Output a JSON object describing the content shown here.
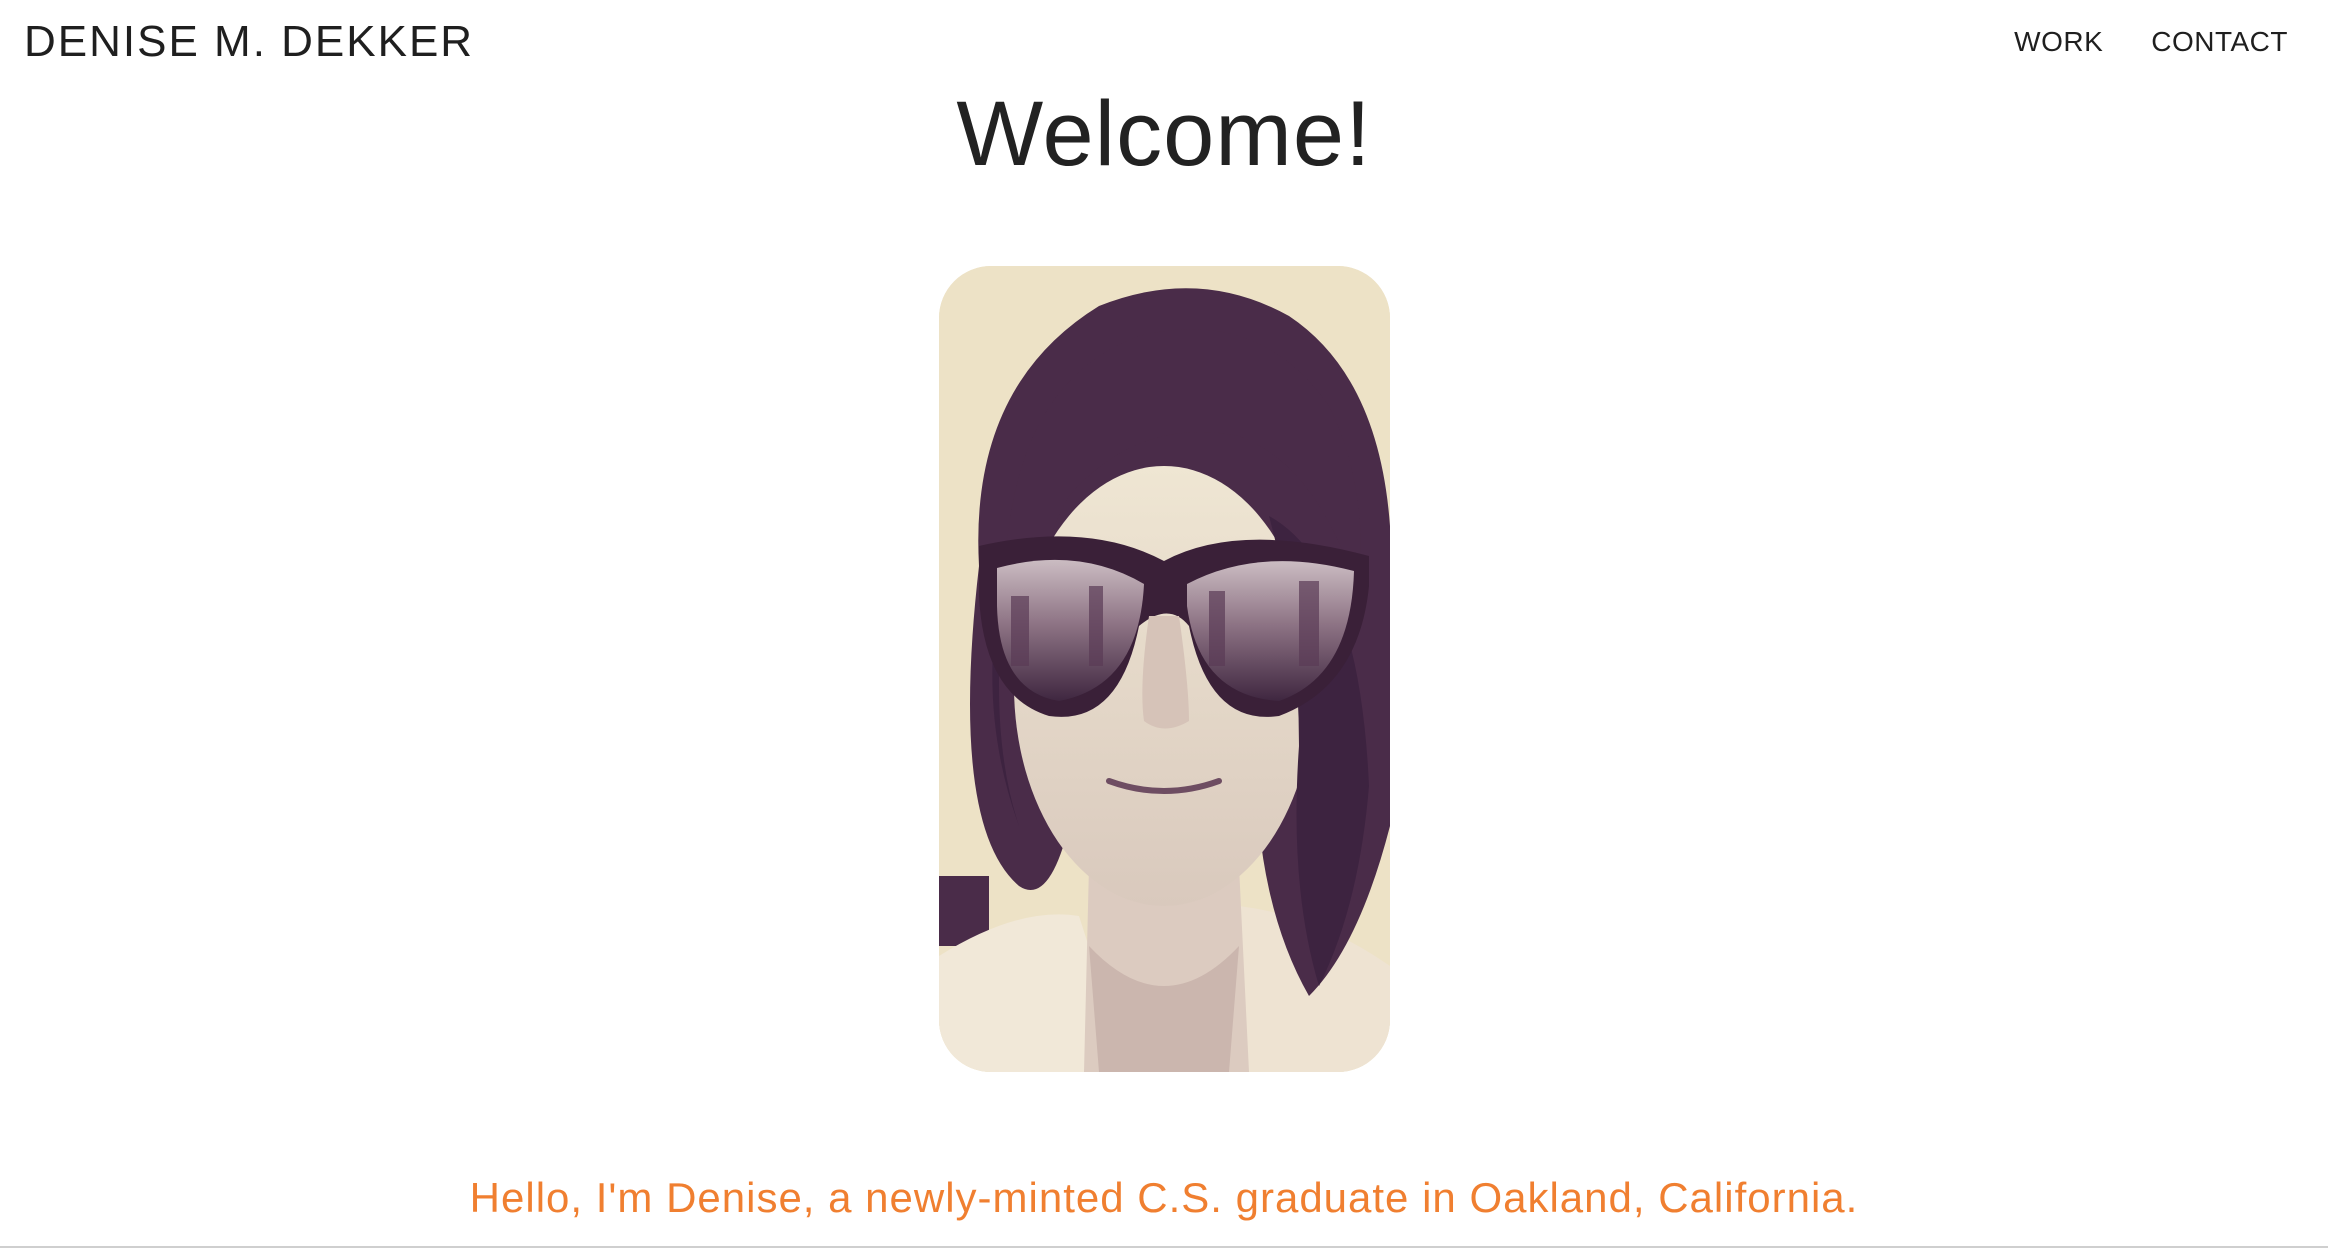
{
  "header": {
    "site_name": "DENISE M. DEKKER",
    "nav": [
      {
        "label": "WORK"
      },
      {
        "label": "CONTACT"
      }
    ]
  },
  "main": {
    "title": "Welcome!",
    "intro": "Hello, I'm Denise, a newly-minted C.S. graduate in Oakland, California."
  },
  "colors": {
    "accent": "#f07f30",
    "text": "#1f1f1f",
    "photo_tint": "#4a2c49",
    "photo_background": "#ede2c6"
  }
}
